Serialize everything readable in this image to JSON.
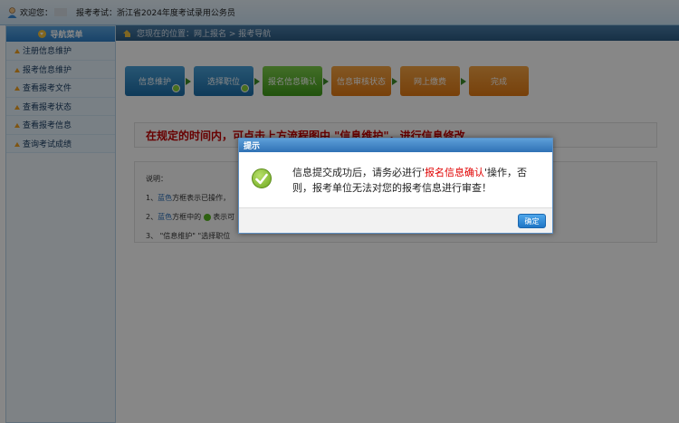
{
  "topbar": {
    "welcome_label": "欢迎您：",
    "exam_label": "报考考试：浙江省2024年度考试录用公务员"
  },
  "sidebar": {
    "header": "导航菜单",
    "items": [
      {
        "label": "注册信息维护"
      },
      {
        "label": "报考信息维护"
      },
      {
        "label": "查看报考文件"
      },
      {
        "label": "查看报考状态"
      },
      {
        "label": "查看报考信息"
      },
      {
        "label": "查询考试成绩"
      }
    ]
  },
  "breadcrumb": "您现在的位置：网上报名 > 报考导航",
  "steps": [
    {
      "label": "信息维护",
      "color": "blue",
      "completed": true
    },
    {
      "label": "选择职位",
      "color": "blue",
      "completed": true
    },
    {
      "label": "报名信息确认",
      "color": "green",
      "completed": false
    },
    {
      "label": "信息审核状态",
      "color": "orange",
      "completed": false
    },
    {
      "label": "网上缴费",
      "color": "orange",
      "completed": false
    },
    {
      "label": "完成",
      "color": "orange",
      "completed": false
    }
  ],
  "notice": "在规定的时间内，可点击上方流程图中 \"信息维护\"，进行信息修改",
  "explain": {
    "title": "说明：",
    "line1_prefix": "1、",
    "line1_blue": "蓝色",
    "line1_rest": "方框表示已操作，",
    "line2_prefix": "2、",
    "line2_blue": "蓝色",
    "line2_rest": "方框中的",
    "line2_tail": "表示可",
    "line3": "3、 \"信息维护\" \"选择职位"
  },
  "dialog": {
    "title": "提示",
    "message_part1": "信息提交成功后，请务必进行'",
    "message_highlight": "报名信息确认",
    "message_part2": "'操作，否则，报考单位无法对您的报考信息进行审查！",
    "ok_label": "确定"
  },
  "colors": {
    "accent_blue": "#2f7fc7",
    "notice_red": "#c40000",
    "step_green": "#3f9c1a",
    "step_orange": "#e27a14"
  }
}
